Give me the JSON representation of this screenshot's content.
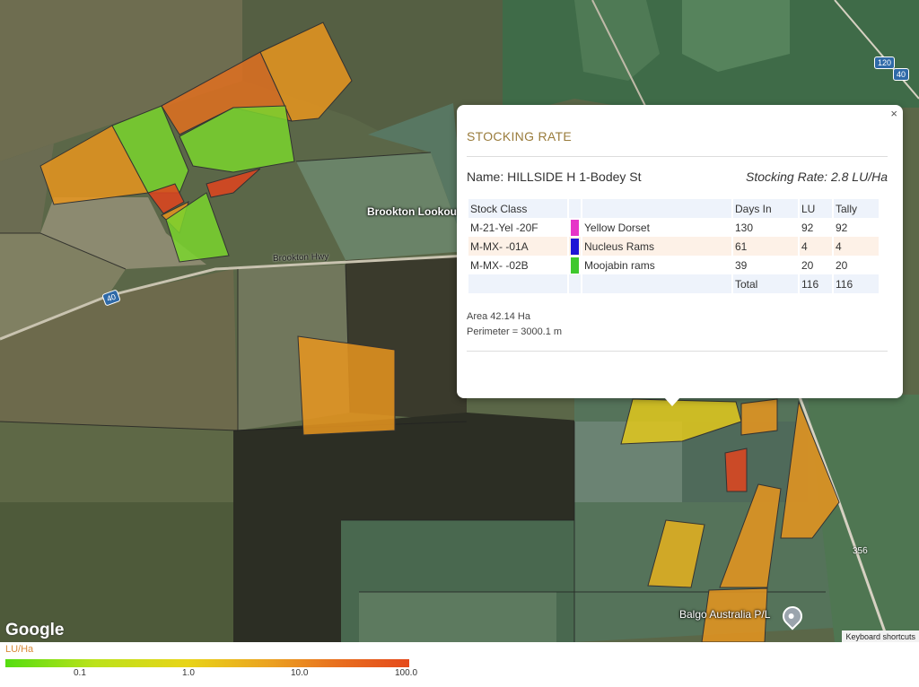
{
  "map": {
    "labels": {
      "brookton_lookout": "Brookton Lookout",
      "brookton_hwy": "Brookton Hwy",
      "place_pin": "Balgo Australia P/L"
    },
    "route_shields": [
      "120",
      "40",
      "40"
    ],
    "road_number": "356",
    "google": "Google",
    "keyboard_shortcuts": "Keyboard shortcuts",
    "paddock_colors": {
      "green": "#7ad52e",
      "orange": "#e8951f",
      "dark_orange": "#e07020",
      "red": "#e0441e",
      "yellow": "#e2c81c",
      "gold": "#e6b21f"
    }
  },
  "popup": {
    "close": "×",
    "title": "STOCKING RATE",
    "name_line": "Name: HILLSIDE H 1-Bodey St",
    "stocking_line": "Stocking Rate: 2.8 LU/Ha",
    "table": {
      "headers": [
        "Stock Class",
        "",
        "Days In",
        "LU",
        "Tally"
      ],
      "rows": [
        {
          "stock_class": "M-21-Yel -20F",
          "color": "#e634c8",
          "breed": "Yellow Dorset",
          "days_in": "130",
          "lu": "92",
          "tally": "92"
        },
        {
          "stock_class": "M-MX- -01A",
          "color": "#1f14d6",
          "breed": "Nucleus Rams",
          "days_in": "61",
          "lu": "4",
          "tally": "4"
        },
        {
          "stock_class": "M-MX- -02B",
          "color": "#3ec82e",
          "breed": "Moojabin rams",
          "days_in": "39",
          "lu": "20",
          "tally": "20"
        }
      ],
      "total": {
        "label": "Total",
        "lu": "116",
        "tally": "116"
      }
    },
    "area": "Area 42.14 Ha",
    "perimeter": "Perimeter = 3000.1 m"
  },
  "legend": {
    "title": "LU/Ha",
    "ticks": [
      "0.1",
      "1.0",
      "10.0",
      "100.0"
    ]
  }
}
